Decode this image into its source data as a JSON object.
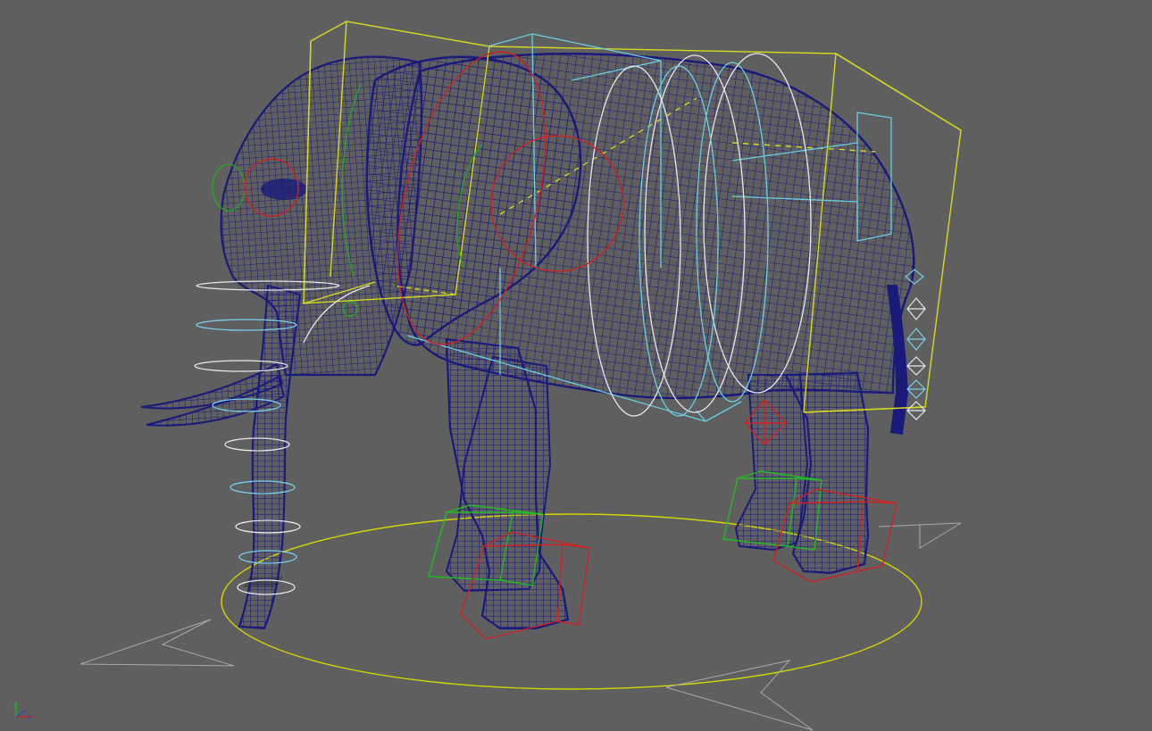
{
  "viewport": {
    "background": "#5f5f5f",
    "mesh_color": "#1a1a7a",
    "mesh_highlight": "#2b2b9a"
  },
  "rig_colors": {
    "root_control": "#d4d400",
    "body_box": "#d8d820",
    "spine_box": "#6ad0e0",
    "ear_left": "#cc2222",
    "ear_right": "#cc2222",
    "eye_left": "#cc2222",
    "eye_right": "#22aa22",
    "foot_left": "#cc2222",
    "foot_right": "#22bb22",
    "trunk_ring_white": "#e8e8e8",
    "trunk_ring_cyan": "#7ad0e8",
    "spine_ring": "#e8e8e8",
    "tail_control": "#e8e8e8",
    "direction_arrow": "#a8a8a8"
  },
  "axis_gizmo": {
    "y_label": "y",
    "z_label": "z",
    "x_color": "#cc2222",
    "y_color": "#22bb22",
    "z_color": "#2244cc"
  },
  "icons": {
    "axis": "view-axis-icon",
    "arrow": "direction-arrow-icon"
  }
}
